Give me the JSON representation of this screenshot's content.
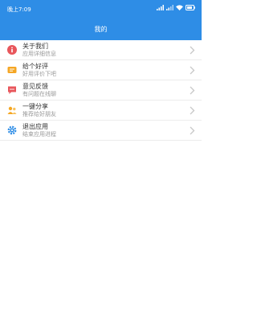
{
  "status_bar": {
    "time": "晚上7:09",
    "icons": [
      "signal-icon",
      "signal-icon",
      "wifi-icon",
      "battery-icon"
    ]
  },
  "header": {
    "title": "我的"
  },
  "menu": {
    "items": [
      {
        "title": "关于我们",
        "subtitle": "应用详细信息",
        "icon": "info-icon",
        "color": "#e8565b"
      },
      {
        "title": "给个好评",
        "subtitle": "好用评价下吧",
        "icon": "rate-icon",
        "color": "#f5a623"
      },
      {
        "title": "意见反馈",
        "subtitle": "有问题在线聊",
        "icon": "feedback-icon",
        "color": "#e8565b"
      },
      {
        "title": "一键分享",
        "subtitle": "推荐给好朋友",
        "icon": "share-icon",
        "color": "#f5a623"
      },
      {
        "title": "退出应用",
        "subtitle": "结束应用进程",
        "icon": "settings-icon",
        "color": "#2e8de6"
      }
    ]
  },
  "colors": {
    "primary": "#2e8de6",
    "background": "#ffffff",
    "divider": "#ececec"
  }
}
